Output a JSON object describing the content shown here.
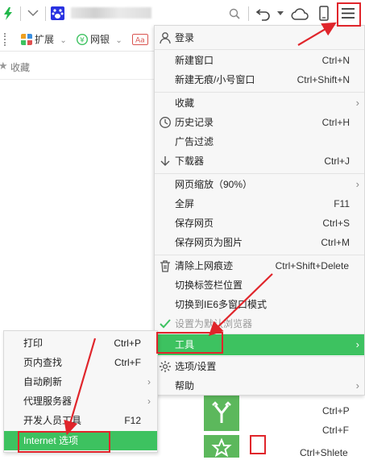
{
  "toolbar": {
    "extensions_label": "扩展",
    "netbank_label": "网银",
    "bookmarks_label": "收藏"
  },
  "main_menu": {
    "items": [
      {
        "label": "登录",
        "shortcut": ""
      },
      {
        "label": "新建窗口",
        "shortcut": "Ctrl+N"
      },
      {
        "label": "新建无痕/小号窗口",
        "shortcut": "Ctrl+Shift+N"
      },
      {
        "label": "收藏",
        "shortcut": ""
      },
      {
        "label": "历史记录",
        "shortcut": "Ctrl+H"
      },
      {
        "label": "广告过滤",
        "shortcut": ""
      },
      {
        "label": "下载器",
        "shortcut": "Ctrl+J"
      },
      {
        "label": "网页缩放（90%）",
        "shortcut": ""
      },
      {
        "label": "全屏",
        "shortcut": "F11"
      },
      {
        "label": "保存网页",
        "shortcut": "Ctrl+S"
      },
      {
        "label": "保存网页为图片",
        "shortcut": "Ctrl+M"
      },
      {
        "label": "清除上网痕迹",
        "shortcut": "Ctrl+Shift+Delete"
      },
      {
        "label": "切换标签栏位置",
        "shortcut": ""
      },
      {
        "label": "切换到IE6多窗口模式",
        "shortcut": ""
      },
      {
        "label": "设置为默认浏览器",
        "shortcut": ""
      },
      {
        "label": "工具",
        "shortcut": ""
      },
      {
        "label": "选项/设置",
        "shortcut": ""
      },
      {
        "label": "帮助",
        "shortcut": ""
      }
    ]
  },
  "sub_menu": {
    "items": [
      {
        "label": "打印",
        "shortcut": "Ctrl+P"
      },
      {
        "label": "页内查找",
        "shortcut": "Ctrl+F"
      },
      {
        "label": "自动刷新",
        "shortcut": ""
      },
      {
        "label": "代理服务器",
        "shortcut": ""
      },
      {
        "label": "开发人员工具",
        "shortcut": "F12"
      },
      {
        "label": "Internet 选项",
        "shortcut": ""
      }
    ]
  },
  "background_shortcuts": [
    "Ctrl+P",
    "Ctrl+F",
    "Ctrl+Shlete"
  ],
  "colors": {
    "accent": "#3dc260",
    "annotation": "#e0252b",
    "tile": "#5cb85c"
  }
}
